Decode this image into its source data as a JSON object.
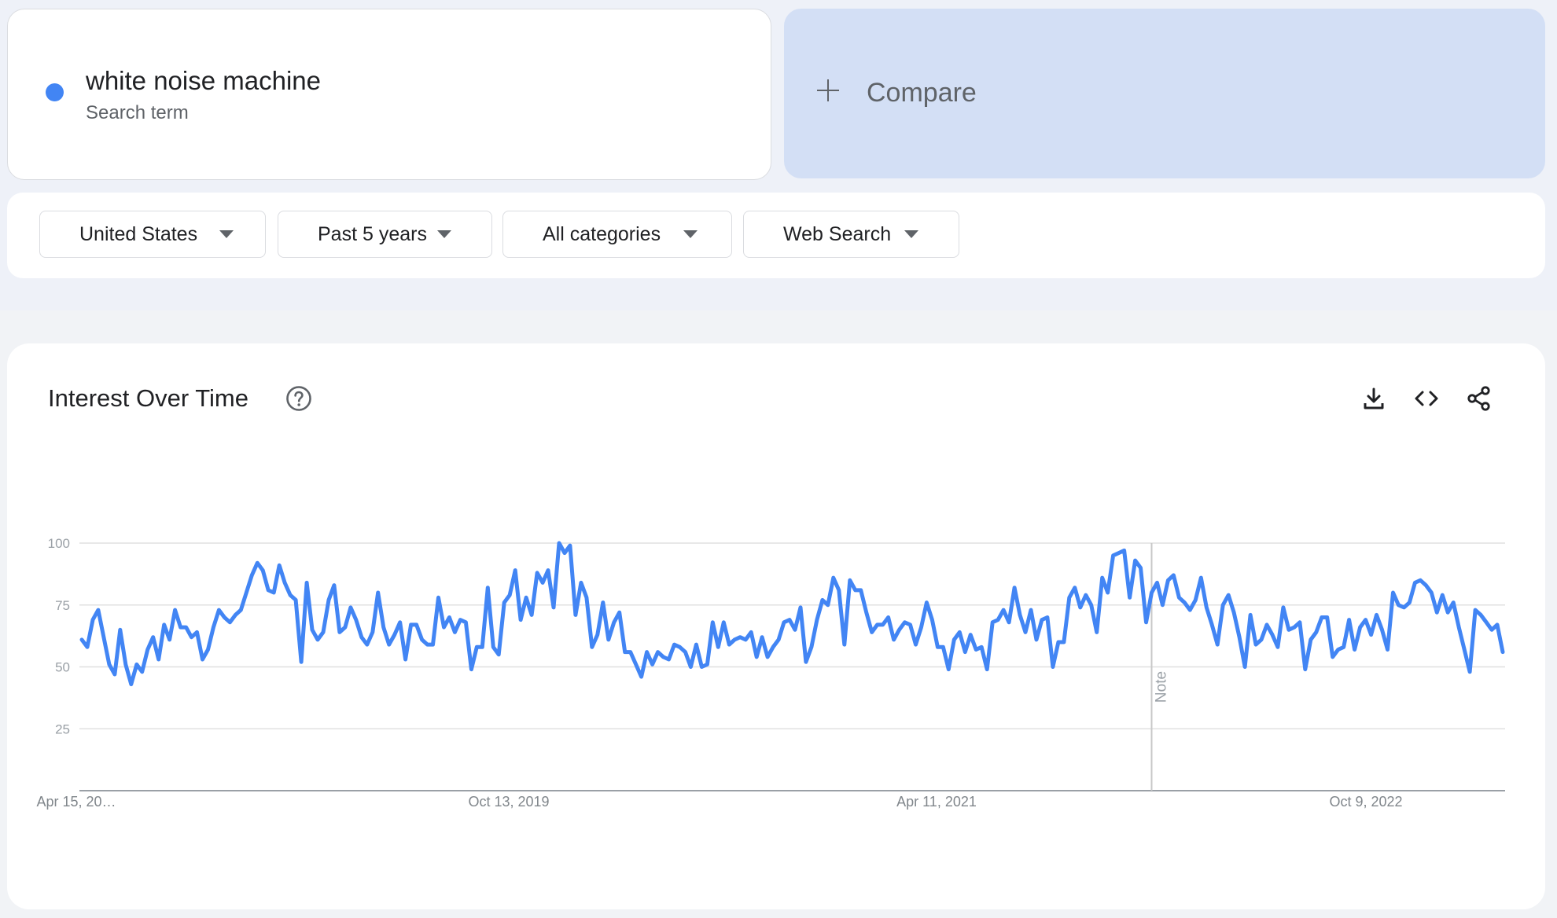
{
  "search_term": {
    "name": "white noise machine",
    "subtitle": "Search term",
    "color": "#4285f4"
  },
  "compare": {
    "label": "Compare",
    "icon": "plus-icon"
  },
  "filters": [
    {
      "label": "United States",
      "icon": "caret-down-icon"
    },
    {
      "label": "Past 5 years",
      "icon": "caret-down-icon"
    },
    {
      "label": "All categories",
      "icon": "caret-down-icon"
    },
    {
      "label": "Web Search",
      "icon": "caret-down-icon"
    }
  ],
  "chart_panel": {
    "title": "Interest Over Time",
    "icons": [
      "help-icon",
      "download-icon",
      "embed-code-icon",
      "share-icon"
    ]
  },
  "chart_data": {
    "type": "line",
    "x_tick_labels": [
      "Apr 15, 20…",
      "Oct 13, 2019",
      "Apr 11, 2021",
      "Oct 9, 2022"
    ],
    "y_ticks": [
      25,
      50,
      75,
      100
    ],
    "ylim": [
      0,
      100
    ],
    "grid": true,
    "annotation": {
      "label": "Note",
      "index": 195
    },
    "series": [
      {
        "color": "#4285f4",
        "values": [
          61,
          58,
          69,
          73,
          62,
          51,
          47,
          65,
          51,
          43,
          51,
          48,
          57,
          62,
          53,
          67,
          61,
          73,
          66,
          66,
          62,
          64,
          53,
          57,
          66,
          73,
          70,
          68,
          71,
          73,
          80,
          87,
          92,
          89,
          81,
          80,
          91,
          84,
          79,
          77,
          52,
          84,
          65,
          61,
          64,
          77,
          83,
          64,
          66,
          74,
          69,
          62,
          59,
          64,
          80,
          66,
          59,
          63,
          68,
          53,
          67,
          67,
          61,
          59,
          59,
          78,
          66,
          70,
          64,
          69,
          68,
          49,
          58,
          58,
          82,
          58,
          55,
          76,
          79,
          89,
          69,
          78,
          71,
          88,
          84,
          89,
          74,
          100,
          96,
          99,
          71,
          84,
          78,
          58,
          63,
          76,
          61,
          68,
          72,
          56,
          56,
          51,
          46,
          56,
          51,
          56,
          54,
          53,
          59,
          58,
          56,
          50,
          59,
          50,
          51,
          68,
          58,
          68,
          59,
          61,
          62,
          61,
          64,
          54,
          62,
          54,
          58,
          61,
          68,
          69,
          65,
          74,
          52,
          58,
          69,
          77,
          75,
          86,
          81,
          59,
          85,
          81,
          81,
          72,
          64,
          67,
          67,
          70,
          61,
          65,
          68,
          67,
          59,
          66,
          76,
          69,
          58,
          58,
          49,
          61,
          64,
          56,
          63,
          57,
          58,
          49,
          68,
          69,
          73,
          68,
          82,
          71,
          64,
          73,
          61,
          69,
          70,
          50,
          60,
          60,
          78,
          82,
          74,
          79,
          75,
          64,
          86,
          80,
          95,
          96,
          97,
          78,
          93,
          90,
          68,
          80,
          84,
          75,
          85,
          87,
          78,
          76,
          73,
          77,
          86,
          74,
          67,
          59,
          75,
          79,
          72,
          62,
          50,
          71,
          59,
          61,
          67,
          63,
          58,
          74,
          65,
          66,
          68,
          49,
          61,
          64,
          70,
          70,
          54,
          57,
          58,
          69,
          57,
          66,
          69,
          63,
          71,
          65,
          57,
          80,
          75,
          74,
          76,
          84,
          85,
          83,
          80,
          72,
          79,
          72,
          76,
          66,
          57,
          48,
          73,
          71,
          68,
          65,
          67,
          56
        ]
      }
    ]
  }
}
